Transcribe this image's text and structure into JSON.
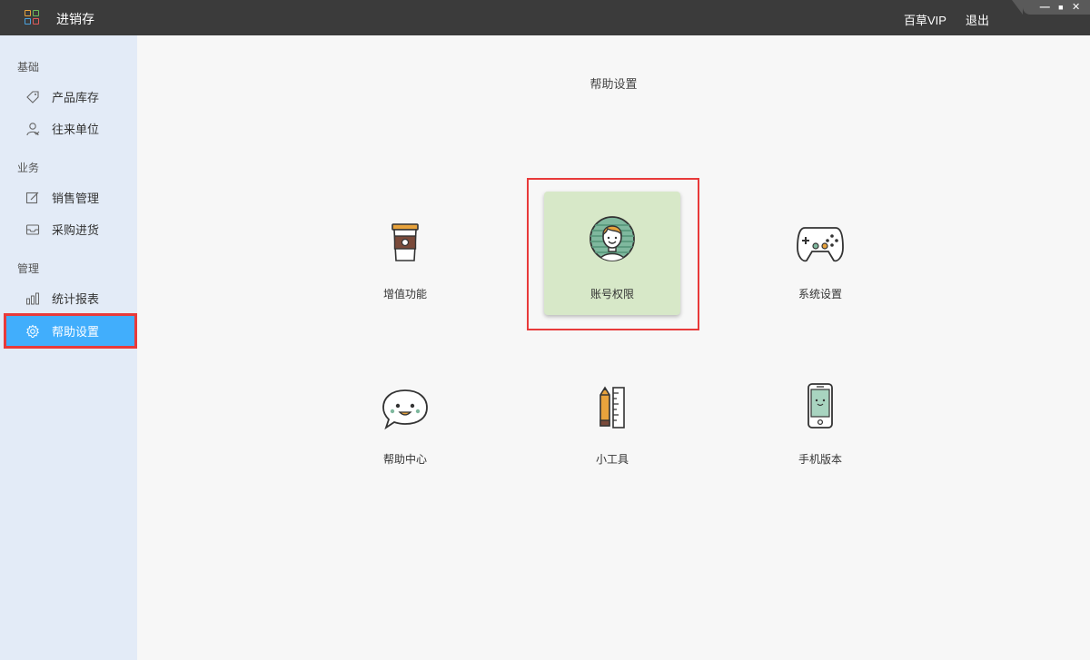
{
  "titlebar": {
    "app_title": "进销存",
    "vip_label": "百草VIP",
    "logout_label": "退出",
    "minimize_glyph": "—",
    "maximize_glyph": "■",
    "close_glyph": "✕"
  },
  "sidebar": {
    "groups": [
      {
        "label": "基础"
      },
      {
        "label": "业务"
      },
      {
        "label": "管理"
      }
    ],
    "items": [
      {
        "label": "产品库存",
        "icon": "tag-icon"
      },
      {
        "label": "往来单位",
        "icon": "contacts-icon"
      },
      {
        "label": "销售管理",
        "icon": "edit-icon"
      },
      {
        "label": "采购进货",
        "icon": "inbox-icon"
      },
      {
        "label": "统计报表",
        "icon": "bar-chart-icon"
      },
      {
        "label": "帮助设置",
        "icon": "gear-icon",
        "active": true
      }
    ]
  },
  "main": {
    "title": "帮助设置",
    "tiles": [
      {
        "label": "增值功能",
        "icon": "coffee-cup-icon"
      },
      {
        "label": "账号权限",
        "icon": "user-avatar-icon",
        "selected": true
      },
      {
        "label": "系统设置",
        "icon": "gamepad-icon"
      },
      {
        "label": "帮助中心",
        "icon": "chat-bubble-icon"
      },
      {
        "label": "小工具",
        "icon": "pencil-ruler-icon"
      },
      {
        "label": "手机版本",
        "icon": "phone-icon"
      }
    ]
  },
  "colors": {
    "titlebar_bg": "#3b3b3b",
    "sidebar_bg": "#e3ebf7",
    "active_item_bg": "#41aefc",
    "selected_tile_bg": "#d7e8c8",
    "highlight_red": "#e83a3a"
  }
}
